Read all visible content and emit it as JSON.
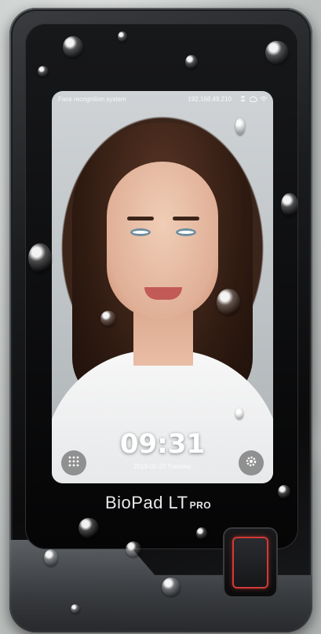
{
  "screen": {
    "status_title": "Face recognition system",
    "ip": "192.168.49.210",
    "status_icons": [
      "usb-icon",
      "cloud-icon",
      "wifi-icon"
    ],
    "clock": "09:31",
    "date": "2019-01-22 Tuesday",
    "left_button_icon": "grid-icon",
    "right_button_icon": "settings-icon"
  },
  "device": {
    "brand_main": "BioPad LT",
    "brand_suffix": "PRO",
    "accent_color": "#d13a35"
  }
}
